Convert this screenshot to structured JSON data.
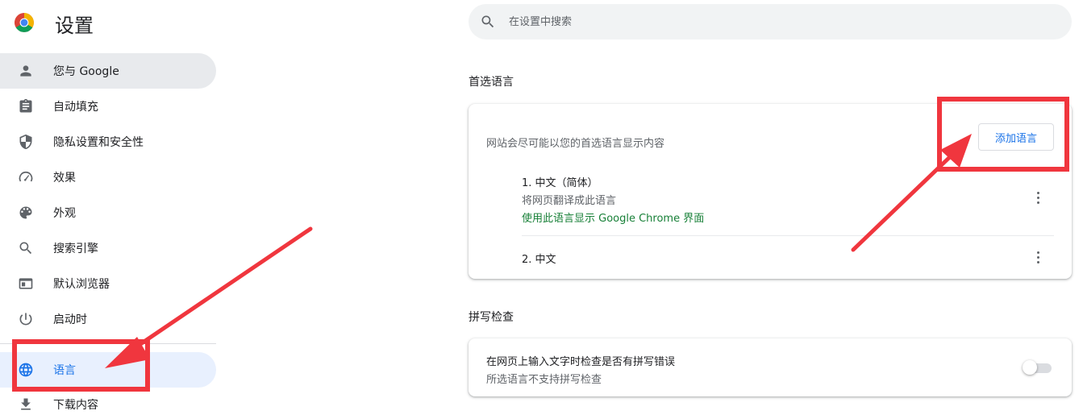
{
  "header": {
    "title": "设置",
    "logo_icon": "chrome-logo"
  },
  "search": {
    "placeholder": "在设置中搜索",
    "icon": "search-icon"
  },
  "sidebar": {
    "items": [
      {
        "label": "您与 Google",
        "icon": "person-icon",
        "state": "hovered"
      },
      {
        "label": "自动填充",
        "icon": "clipboard-icon"
      },
      {
        "label": "隐私设置和安全性",
        "icon": "shield-icon"
      },
      {
        "label": "效果",
        "icon": "speedometer-icon"
      },
      {
        "label": "外观",
        "icon": "palette-icon"
      },
      {
        "label": "搜索引擎",
        "icon": "search-icon"
      },
      {
        "label": "默认浏览器",
        "icon": "browser-icon"
      },
      {
        "label": "启动时",
        "icon": "power-icon"
      },
      {
        "label": "语言",
        "icon": "globe-icon",
        "state": "selected"
      },
      {
        "label": "下载内容",
        "icon": "download-icon"
      }
    ]
  },
  "languages": {
    "section_title": "首选语言",
    "description": "网站会尽可能以您的首选语言显示内容",
    "add_button": "添加语言",
    "items": [
      {
        "name": "1. 中文（简体）",
        "sub": "将网页翻译成此语言",
        "ui_note": "使用此语言显示 Google Chrome 界面"
      },
      {
        "name": "2. 中文"
      }
    ]
  },
  "spellcheck": {
    "section_title": "拼写检查",
    "title": "在网页上输入文字时检查是否有拼写错误",
    "subtitle": "所选语言不支持拼写检查",
    "enabled": false
  },
  "colors": {
    "accent": "#1a73e8",
    "selected_bg": "#e8f0fe",
    "hover_bg": "#e8eaed",
    "green_text": "#188038",
    "annotation_red": "#f0363e"
  }
}
